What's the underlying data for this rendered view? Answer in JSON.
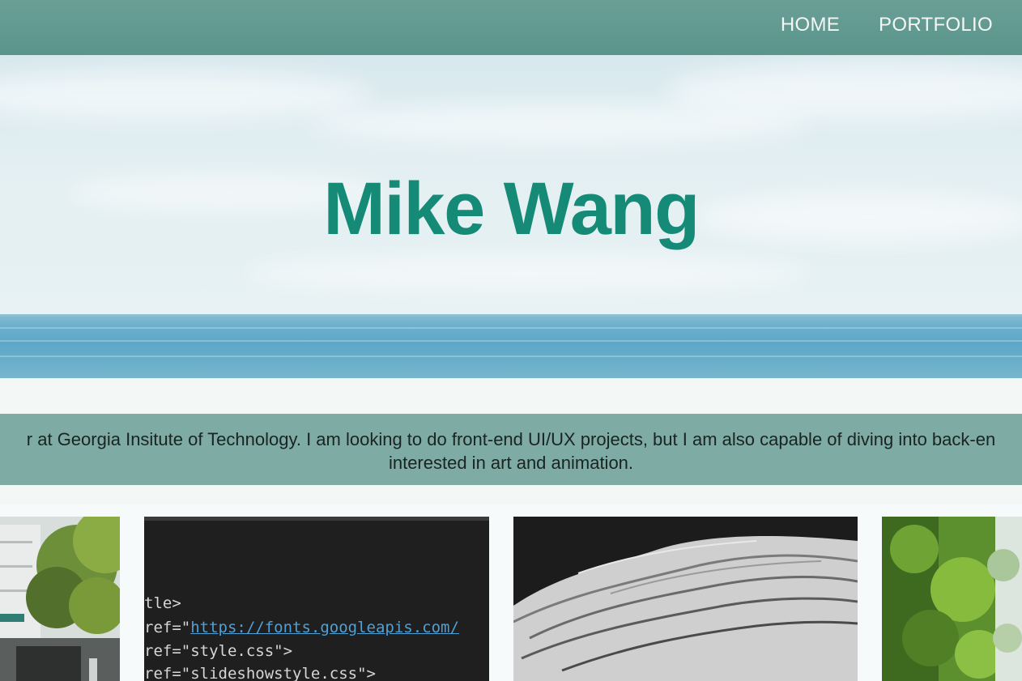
{
  "nav": {
    "links": [
      "HOME",
      "PORTFOLIO"
    ]
  },
  "hero": {
    "title": "Mike Wang"
  },
  "intro": {
    "line1": "r at Georgia Insitute of Technology. I am looking to do front-end UI/UX projects, but I am also capable of diving into back-en",
    "line2": "interested in art and animation."
  },
  "gallery": {
    "code_lines": [
      {
        "pre": "tle>",
        "url": "",
        "post": ""
      },
      {
        "pre": "ref=\"",
        "url": "https://fonts.googleapis.com/",
        "post": ""
      },
      {
        "pre": "ref=\"style.css\">",
        "url": "",
        "post": ""
      },
      {
        "pre": "ref=\"slideshowstyle.css\">",
        "url": "",
        "post": ""
      }
    ]
  },
  "colors": {
    "nav": "#5e988f",
    "title": "#158a76",
    "intro_band": "#7eaba3"
  }
}
